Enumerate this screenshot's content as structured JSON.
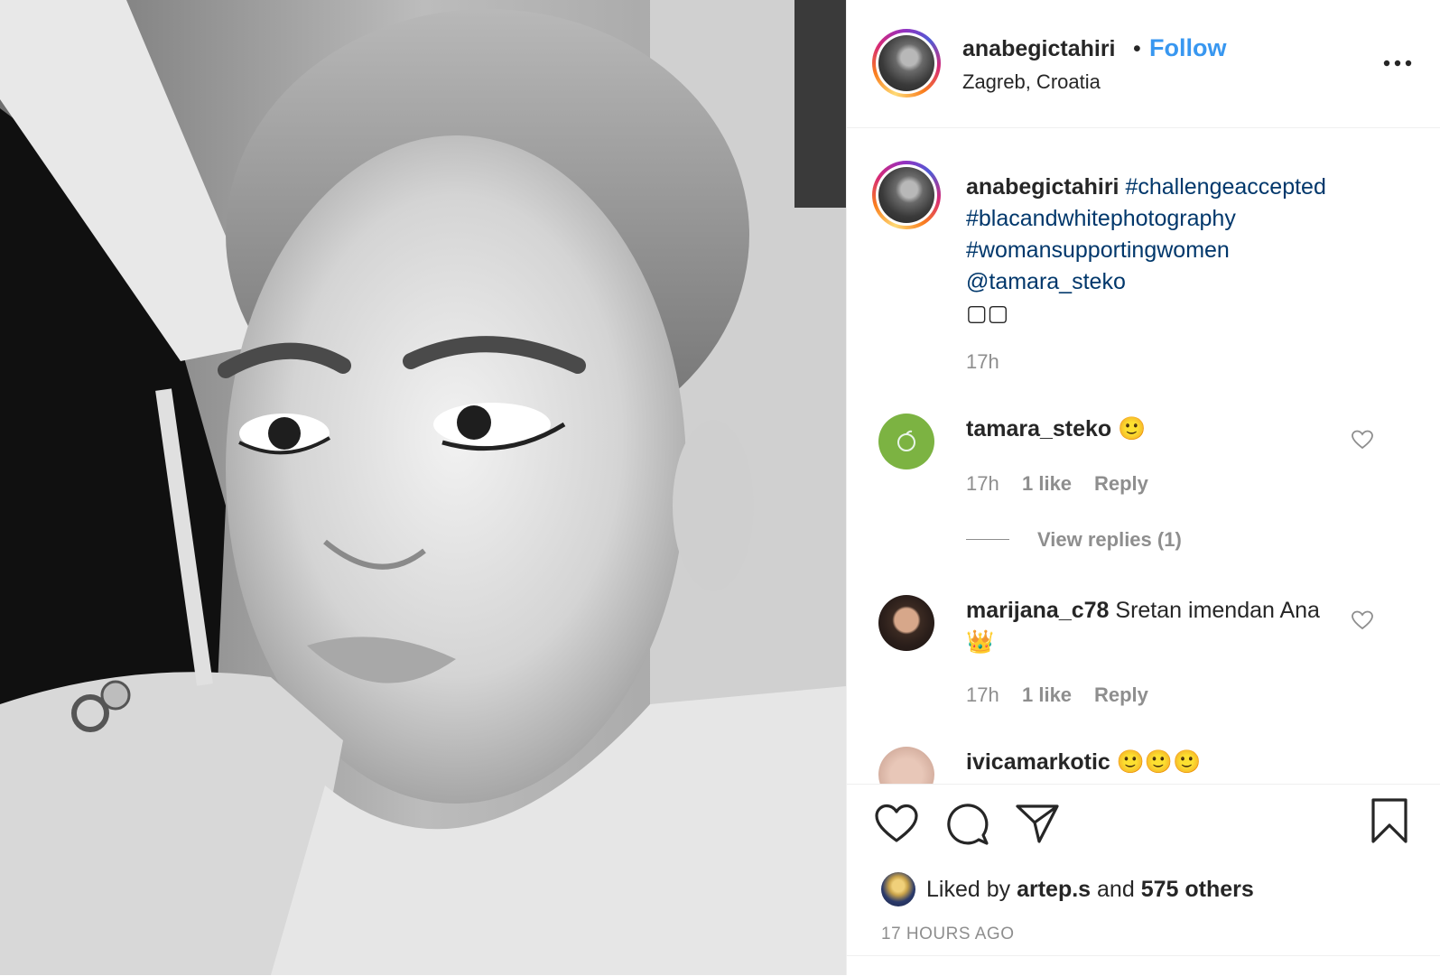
{
  "post": {
    "username": "anabegictahiri",
    "follow_label": "Follow",
    "separator": "•",
    "location": "Zagreb, Croatia",
    "photo_description_icon": "portrait-photo"
  },
  "caption": {
    "username": "anabegictahiri",
    "hashtags": [
      "#challengeaccepted",
      "#blacandwhitephotography",
      "#womansupportingwomen"
    ],
    "mention": "@tamara_steko",
    "emoji": "▢▢",
    "time": "17h"
  },
  "comments": [
    {
      "username": "tamara_steko",
      "text": "🙂",
      "time": "17h",
      "likes": "1 like",
      "reply_label": "Reply",
      "view_replies": "View replies (1)"
    },
    {
      "username": "marijana_c78",
      "text": "Sretan imendan Ana👑",
      "time": "17h",
      "likes": "1 like",
      "reply_label": "Reply"
    },
    {
      "username": "ivicamarkotic",
      "text": "🙂🙂🙂"
    }
  ],
  "actions": {
    "liked_by_prefix": "Liked by",
    "liked_by_user": "artep.s",
    "liked_by_and": "and",
    "liked_by_others": "575 others",
    "timestamp": "17 HOURS AGO"
  },
  "colors": {
    "link_blue": "#3897f0",
    "hashtag": "#00376b",
    "muted": "#8e8e8e",
    "text": "#262626"
  }
}
